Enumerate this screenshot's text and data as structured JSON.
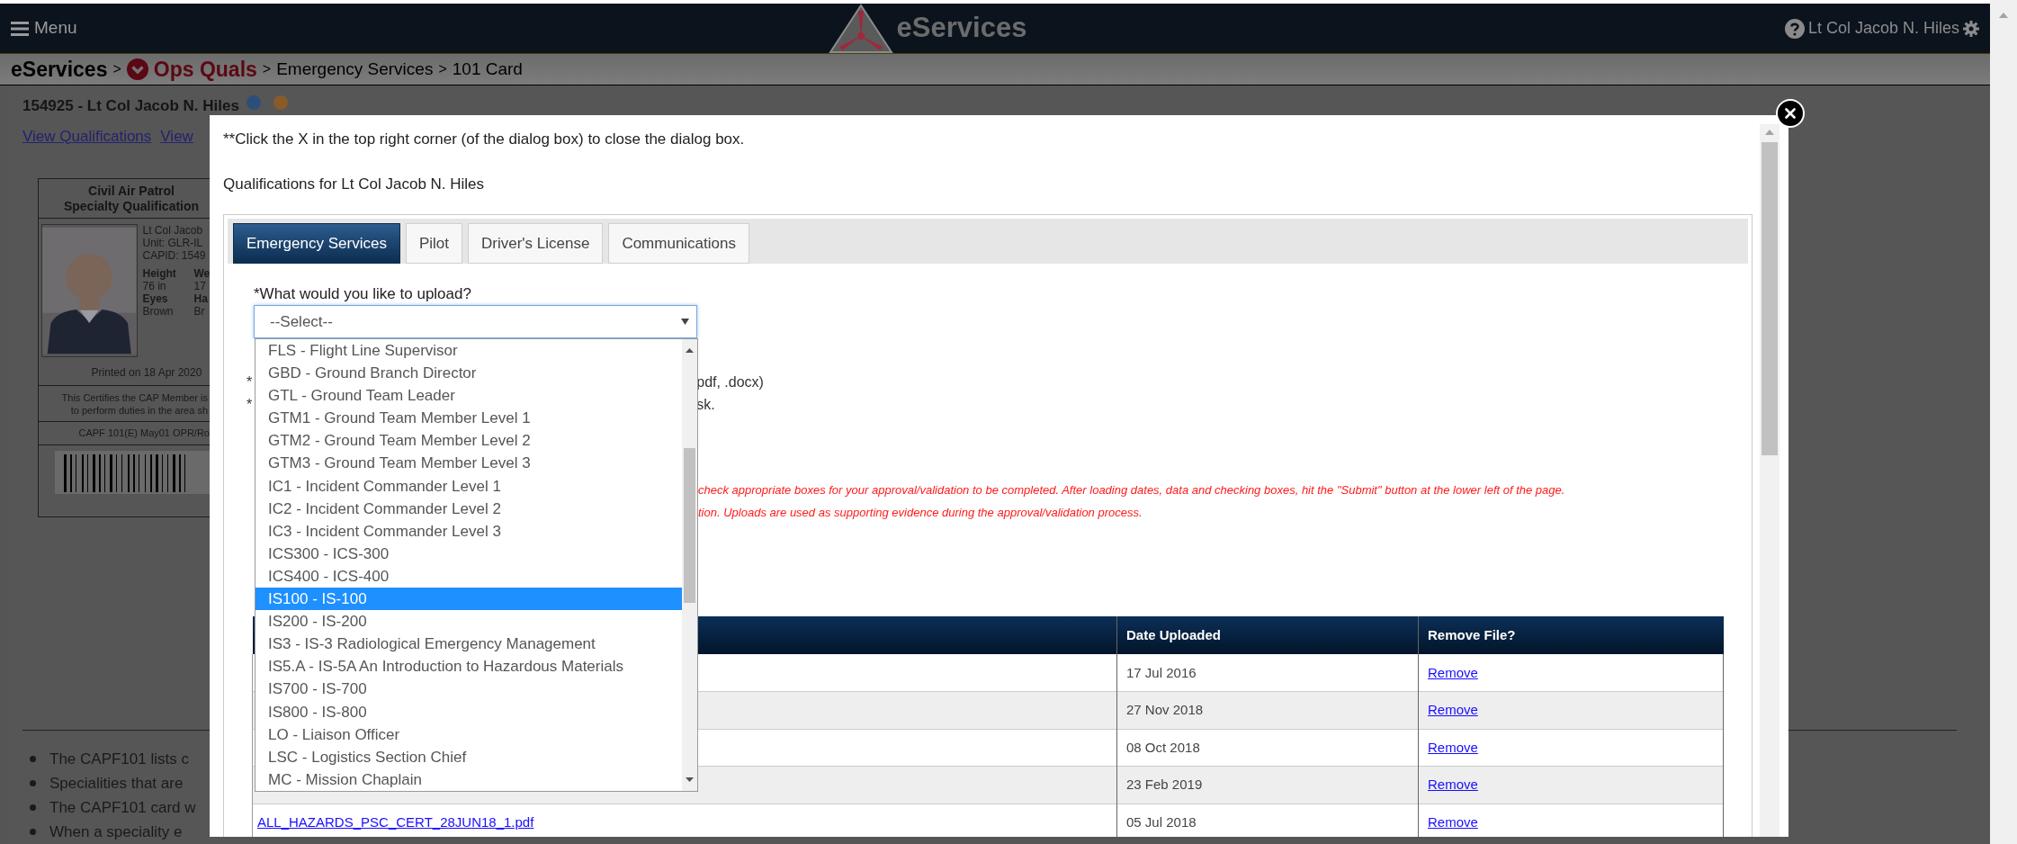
{
  "header": {
    "menu_label": "Menu",
    "logo_text": "eServices",
    "user_name": "Lt Col Jacob N. Hiles"
  },
  "breadcrumb": [
    {
      "kind": "root",
      "label": "eServices"
    },
    {
      "kind": "section",
      "separator": ">",
      "label": "Ops Quals"
    },
    {
      "kind": "plain",
      "separator": ">",
      "label": "Emergency Services"
    },
    {
      "kind": "plain",
      "separator": ">",
      "label": "101 Card"
    }
  ],
  "member": {
    "title": "154925 - Lt Col Jacob N. Hiles",
    "links": [
      "View Qualifications",
      "View"
    ]
  },
  "card": {
    "title_lines": [
      "Civil Air Patrol",
      "Specialty Qualification"
    ],
    "details": [
      "Lt Col Jacob",
      "Unit: GLR-IL",
      "CAPID: 1549"
    ],
    "stats": [
      {
        "label": "Height",
        "value": "76 in",
        "label_2": "We",
        "value_2": "17"
      },
      {
        "label": "Eyes",
        "value": "Brown",
        "label_2": "Ha",
        "value_2": "Br"
      }
    ],
    "printed": "Printed on 18 Apr 2020",
    "certify_lines": [
      "This Certifies the CAP Member is",
      "to perform duties in the area sh"
    ],
    "form_id": "CAPF 101(E) May01 OPR/Ro"
  },
  "notes": [
    "The CAPF101 lists c",
    "Specialities that are",
    "The CAPF101 card w",
    "When a speciality e"
  ],
  "dialog": {
    "instruction": "**Click the X in the top right corner (of the dialog box) to close the dialog box.",
    "heading": "Qualifications for Lt Col Jacob N. Hiles",
    "tabs": [
      {
        "label": "Emergency Services",
        "selected": true
      },
      {
        "label": "Pilot",
        "selected": false
      },
      {
        "label": "Driver's License",
        "selected": false
      },
      {
        "label": "Communications",
        "selected": false
      }
    ],
    "upload_label": "*What would you like to upload?",
    "select_value": "--Select--",
    "options": [
      {
        "label": "FLS - Flight Line Supervisor",
        "selected": false
      },
      {
        "label": "GBD - Ground Branch Director",
        "selected": false
      },
      {
        "label": "GTL - Ground Team Leader",
        "selected": false
      },
      {
        "label": "GTM1 - Ground Team Member Level 1",
        "selected": false
      },
      {
        "label": "GTM2 - Ground Team Member Level 2",
        "selected": false
      },
      {
        "label": "GTM3 - Ground Team Member Level 3",
        "selected": false
      },
      {
        "label": "IC1 - Incident Commander Level 1",
        "selected": false
      },
      {
        "label": "IC2 - Incident Commander Level 2",
        "selected": false
      },
      {
        "label": "IC3 - Incident Commander Level 3",
        "selected": false
      },
      {
        "label": "ICS300 - ICS-300",
        "selected": false
      },
      {
        "label": "ICS400 - ICS-400",
        "selected": false
      },
      {
        "label": "IS100 - IS-100",
        "selected": true
      },
      {
        "label": "IS200 - IS-200",
        "selected": false
      },
      {
        "label": "IS3 - IS-3 Radiological Emergency Management",
        "selected": false
      },
      {
        "label": "IS5.A - IS-5A An Introduction to Hazardous Materials",
        "selected": false
      },
      {
        "label": "IS700 - IS-700",
        "selected": false
      },
      {
        "label": "IS800 - IS-800",
        "selected": false
      },
      {
        "label": "LO - Liaison Officer",
        "selected": false
      },
      {
        "label": "LSC - Logistics Section Chief",
        "selected": false
      },
      {
        "label": "MC - Mission Chaplain",
        "selected": false
      }
    ],
    "partial_lines": [
      {
        "star": "*",
        "text": "pdf, .docx)"
      },
      {
        "star": "*",
        "text": "sk."
      }
    ],
    "notice_lines": [
      "check appropriate boxes for your approval/validation to be completed. After loading dates, data and checking boxes, hit the \"Submit\" button at the lower left of the page.",
      "tion. Uploads are used as supporting evidence during the approval/validation process."
    ],
    "table": {
      "columns": [
        "Date Uploaded",
        "Remove File?"
      ],
      "rows": [
        {
          "date": "17 Jul 2016",
          "action": "Remove"
        },
        {
          "date": "27 Nov 2018",
          "action": "Remove"
        },
        {
          "date": "08 Oct 2018",
          "action": "Remove"
        },
        {
          "date": "23 Feb 2019",
          "action": "Remove"
        },
        {
          "file": "ALL_HAZARDS_PSC_CERT_28JUN18_1.pdf",
          "date": "05 Jul 2018",
          "action": "Remove"
        }
      ]
    }
  }
}
